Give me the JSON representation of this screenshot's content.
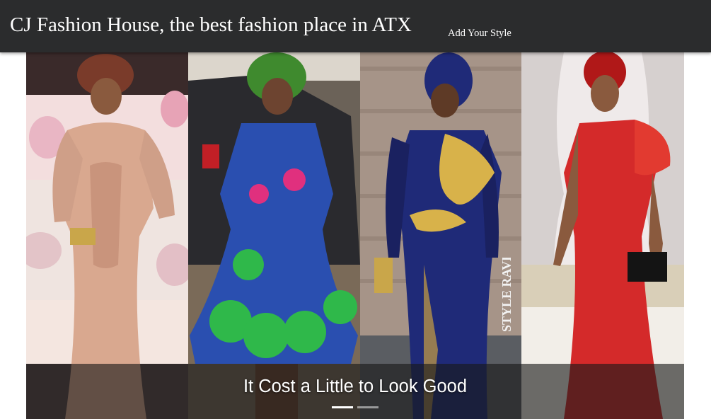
{
  "header": {
    "brand": "CJ Fashion House, the best fashion place in ATX",
    "nav_link": "Add Your Style"
  },
  "carousel": {
    "caption": "It Cost a Little to Look Good",
    "watermark": "STYLE RAVE",
    "active_index": 0,
    "indicator_count": 2,
    "slides": [
      {
        "name": "peach-lace-gown",
        "dress_color": "#d9a88f",
        "accent": "#7a3b2a"
      },
      {
        "name": "ankara-print-dress",
        "dress_color": "#2a4fb0",
        "accent": "#2fb84a"
      },
      {
        "name": "navy-gold-gown",
        "dress_color": "#1f2a78",
        "accent": "#d8b24a"
      },
      {
        "name": "red-feather-gown",
        "dress_color": "#d42a2a",
        "accent": "#b01818"
      }
    ]
  }
}
